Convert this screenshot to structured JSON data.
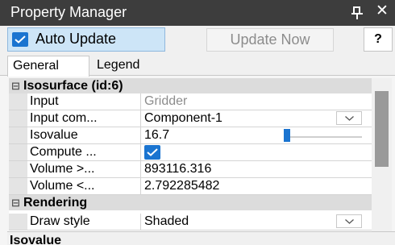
{
  "window": {
    "title": "Property Manager",
    "pin_icon": "pin-icon",
    "close_icon": "close-icon",
    "close_glyph": "✕"
  },
  "toolbar": {
    "auto_update_label": "Auto Update",
    "auto_update_checked": true,
    "update_now_label": "Update Now",
    "help_label": "?"
  },
  "tabs": [
    {
      "label": "General",
      "active": true
    },
    {
      "label": "Legend",
      "active": false
    }
  ],
  "categories": [
    {
      "toggle": "⊟",
      "name": "Isosurface (id:6)"
    },
    {
      "toggle": "⊟",
      "name": "Rendering"
    }
  ],
  "properties": [
    {
      "key": "Input",
      "value": "Gridder"
    },
    {
      "key": "Input com...",
      "value": "Component-1"
    },
    {
      "key": "Isovalue",
      "value": "16.7",
      "slider_fraction": 0.0
    },
    {
      "key": "Compute ...",
      "checked": true
    },
    {
      "key": "Volume >...",
      "value": "893116.316"
    },
    {
      "key": "Volume <...",
      "value": "2.792285482"
    },
    {
      "key": "Draw style",
      "value": "Shaded"
    }
  ],
  "description": {
    "title": "Isovalue"
  },
  "colors": {
    "titlebar": "#3d3d3d",
    "accent": "#1a74d0",
    "category_bg": "#dcdcdc",
    "toggle_active_bg": "#cde5f7"
  }
}
